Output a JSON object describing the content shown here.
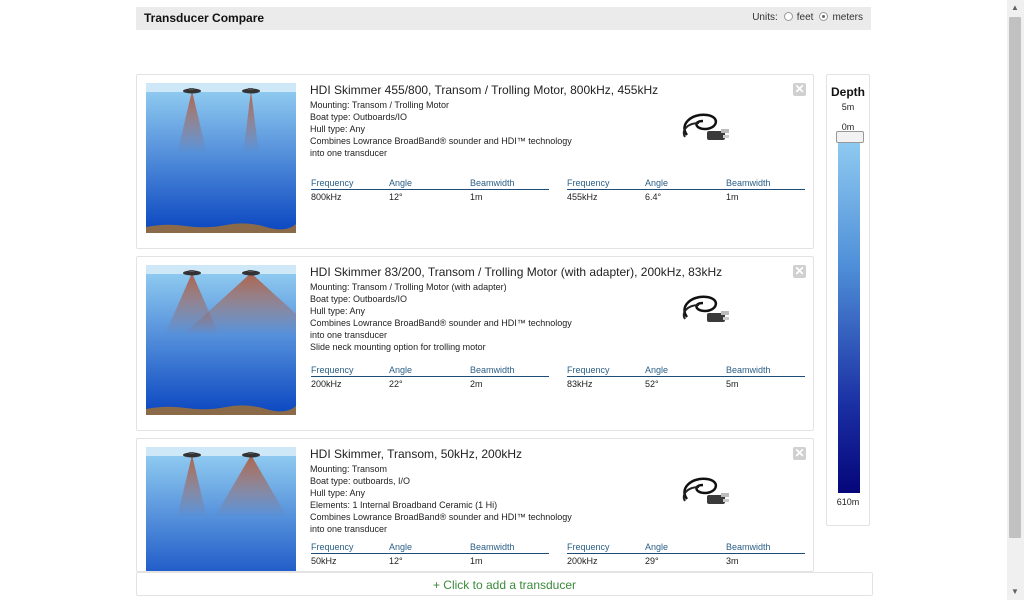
{
  "header": {
    "title": "Transducer Compare",
    "units_label": "Units:",
    "unit_feet": "feet",
    "unit_meters": "meters",
    "selected_unit": "meters"
  },
  "transducers": [
    {
      "name": "HDI Skimmer 455/800, Transom / Trolling Motor, 800kHz, 455kHz",
      "lines": [
        "Mounting: Transom / Trolling Motor",
        "Boat type: Outboards/IO",
        "Hull type: Any",
        "Combines Lowrance BroadBand® sounder and HDI™ technology",
        "into one transducer"
      ],
      "spec_headers": [
        "Frequency",
        "Angle",
        "Beamwidth"
      ],
      "specs": [
        {
          "frequency": "800kHz",
          "angle": "12°",
          "beamwidth": "1m"
        },
        {
          "frequency": "455kHz",
          "angle": "6.4°",
          "beamwidth": "1m"
        }
      ],
      "beams": [
        12,
        6.4
      ],
      "close_icon": "close-icon",
      "image_icon": "transducer-product-icon"
    },
    {
      "name": "HDI Skimmer 83/200, Transom / Trolling Motor (with adapter), 200kHz, 83kHz",
      "lines": [
        "Mounting: Transom / Trolling Motor (with adapter)",
        "Boat type: Outboards/IO",
        "Hull type: Any",
        "Combines Lowrance BroadBand® sounder and HDI™ technology",
        "into one transducer",
        "Slide neck mounting option for trolling motor"
      ],
      "spec_headers": [
        "Frequency",
        "Angle",
        "Beamwidth"
      ],
      "specs": [
        {
          "frequency": "200kHz",
          "angle": "22°",
          "beamwidth": "2m"
        },
        {
          "frequency": "83kHz",
          "angle": "52°",
          "beamwidth": "5m"
        }
      ],
      "beams": [
        22,
        52
      ],
      "close_icon": "close-icon",
      "image_icon": "transducer-product-icon"
    },
    {
      "name": "HDI Skimmer, Transom, 50kHz, 200kHz",
      "lines": [
        "Mounting: Transom",
        "Boat type: outboards, I/O",
        "Hull type: Any",
        "Elements: 1 Internal Broadband Ceramic (1 Hi)",
        "Combines Lowrance BroadBand® sounder and HDI™ technology",
        "into one transducer"
      ],
      "spec_headers": [
        "Frequency",
        "Angle",
        "Beamwidth"
      ],
      "specs": [
        {
          "frequency": "50kHz",
          "angle": "12°",
          "beamwidth": "1m"
        },
        {
          "frequency": "200kHz",
          "angle": "29°",
          "beamwidth": "3m"
        }
      ],
      "beams": [
        12,
        29
      ],
      "close_icon": "close-icon",
      "image_icon": "transducer-product-icon"
    }
  ],
  "depth": {
    "title": "Depth",
    "current": "5m",
    "min": "0m",
    "max": "610m"
  },
  "add_button": "+ Click to add a transducer",
  "colors": {
    "spec_header": "#2a5f87",
    "add_text": "#3a8a3a",
    "water_top": "#8ec9f0",
    "water_bottom": "#0a46c0",
    "seabed": "#8b6a4a"
  }
}
